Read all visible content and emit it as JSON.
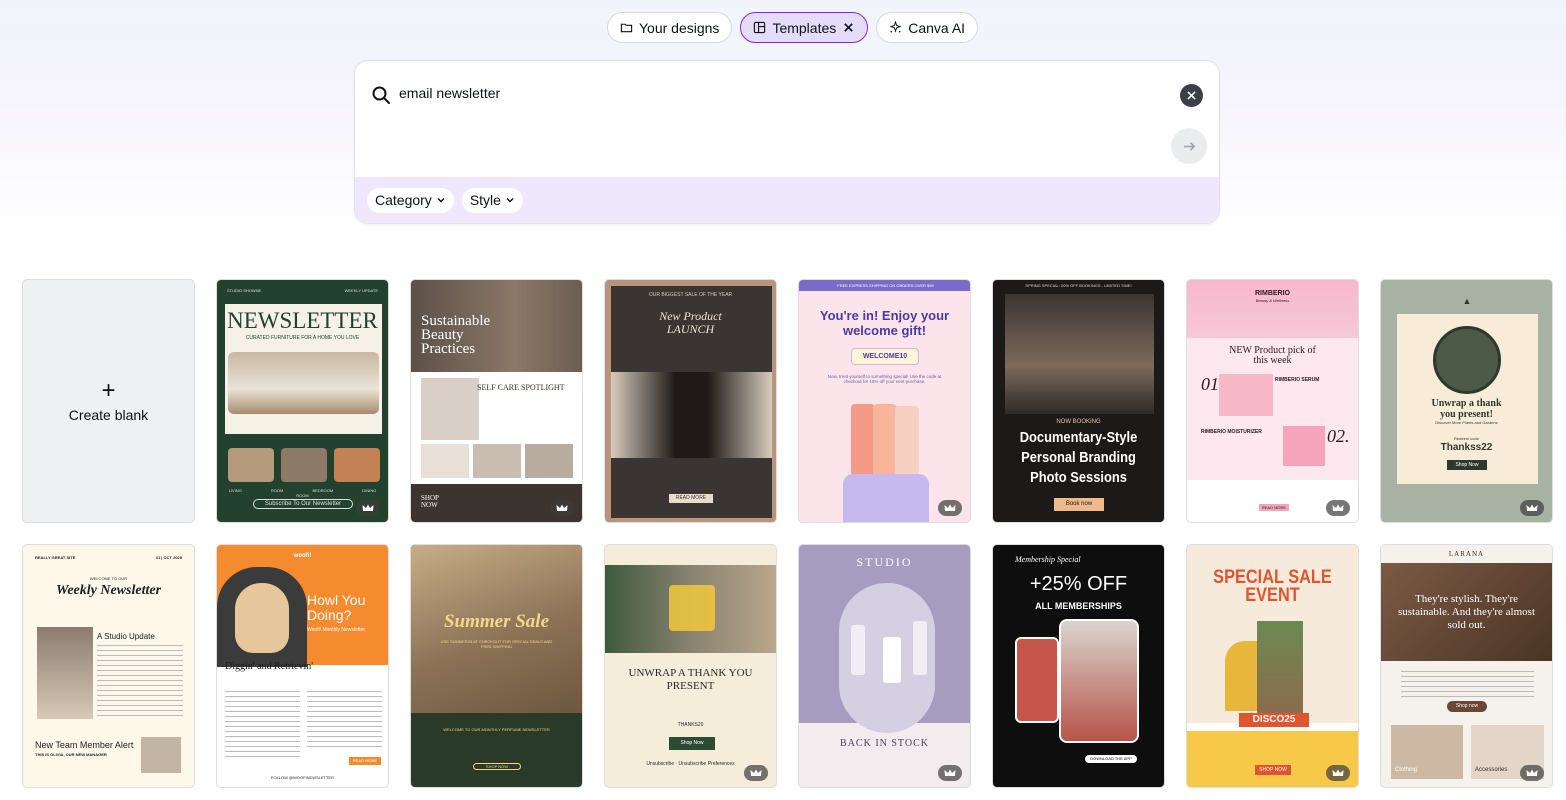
{
  "tabs": [
    {
      "label": "Your designs",
      "icon": "folder-icon"
    },
    {
      "label": "Templates",
      "icon": "template-icon",
      "active": true
    },
    {
      "label": "Canva AI",
      "icon": "sparkle-icon"
    }
  ],
  "search": {
    "value": "email newsletter",
    "filters": [
      "Category",
      "Style"
    ]
  },
  "create_blank": "Create blank",
  "templates": {
    "t1": {
      "top": "STUDIO SHOWNE",
      "top2": "WEEKLY UPDATE",
      "title": "NEWSLETTER",
      "sub": "CURATED FURNITURE FOR A HOME YOU LOVE",
      "c1": "LIVING ROOM",
      "c2": "BEDROOM",
      "c3": "DINING ROOM",
      "btn": "Subscribe To Our Newsletter"
    },
    "t2": {
      "title": "Sustainable Beauty Practices",
      "h": "SELF CARE SPOTLIGHT",
      "shop": "SHOP NOW"
    },
    "t3": {
      "top": "OUR BIGGEST SALE OF THE YEAR",
      "title": "New Product LAUNCH",
      "btn": "READ MORE"
    },
    "t4": {
      "top": "FREE EXPRESS SHIPPING ON ORDERS OVER $99",
      "title": "You're in! Enjoy your welcome gift!",
      "code": "WELCOME10",
      "body": "Now, treat yourself to something special! Use the code at checkout for 15% off your next purchase."
    },
    "t5": {
      "top": "SPRING SPECIAL: 20% OFF BOOKINGS - LIMITED TIME!",
      "tag": "NOW BOOKING",
      "title": "Documentary-Style Personal Branding Photo Sessions",
      "btn": "Book now"
    },
    "t6": {
      "brand": "RIMBERIO",
      "sub": "Beauty & Wellness",
      "title": "NEW Product pick of this week",
      "n1": "01.",
      "p1": "RIMBERIO SERUM",
      "n2": "02.",
      "p2": "RIMBERIO MOISTURIZER",
      "btn": "READ MORE"
    },
    "t7": {
      "title": "Unwrap a thank you present!",
      "sub": "Discover More Plants and Gardens",
      "code_label": "Redeem code",
      "code": "Thankss22",
      "btn": "Shop Now"
    },
    "t8": {
      "top": "REALLY GREAT SITE",
      "date": "#1 | OCT 2025",
      "welcome": "WELCOME TO OUR",
      "title": "Weekly Newsletter",
      "h": "A Studio Update",
      "alert": "New Team Member Alert",
      "alert_sub": "THIS IS OLIVIA, OUR NEW MANAGER"
    },
    "t9": {
      "brand": "woofi!",
      "title": "Howl You Doing?",
      "sub": "Woofi! Monthly Newsletter",
      "h": "Diggin' and Retrievin'",
      "btn": "READ MORE",
      "foot": "FOLLOW @WOOFINEWSLETTER"
    },
    "t10": {
      "title": "Summer Sale",
      "sub": "USE SUMMER25 AT CHECKOUT FOR SPECIAL DEALS AND FREE SHIPPING",
      "welcome": "WELCOME TO OUR MONTHLY PERFUME NEWSLETTER",
      "btn": "SHOP NOW"
    },
    "t11": {
      "title": "UNWRAP A THANK YOU PRESENT",
      "code": "THANKS20",
      "btn": "Shop Now",
      "foot": "Unsubscribe · Unsubscribe Preferences"
    },
    "t12": {
      "brand": "STUDIO",
      "title": "BACK IN STOCK"
    },
    "t13": {
      "tag": "Membership Special",
      "title": "+25% OFF",
      "sub": "ALL MEMBERSHIPS",
      "btn": "DOWNLOAD THE APP"
    },
    "t14": {
      "title": "SPECIAL SALE EVENT",
      "code": "DISCO25",
      "btn": "SHOP NOW"
    },
    "t15": {
      "brand": "LARANA",
      "title": "They're stylish. They're sustainable. And they're almost sold out.",
      "btn": "Shop now",
      "c1": "Clothing",
      "c2": "Accessories"
    }
  }
}
